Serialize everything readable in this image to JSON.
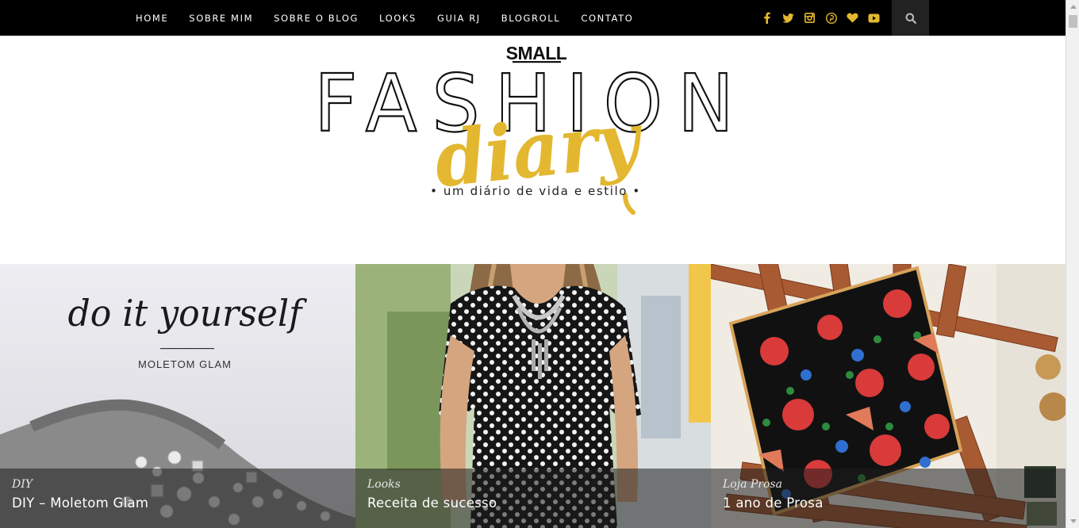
{
  "nav": {
    "items": [
      "HOME",
      "SOBRE MIM",
      "SOBRE O BLOG",
      "LOOKS",
      "GUIA RJ",
      "BLOGROLL",
      "CONTATO"
    ]
  },
  "social": {
    "icons": [
      "facebook-icon",
      "twitter-icon",
      "instagram-icon",
      "pinterest-icon",
      "bloglovin-heart-icon",
      "youtube-icon"
    ],
    "color": "#e3b730"
  },
  "logo": {
    "small": "SMALL",
    "fashion": "FASHION",
    "diary": "diary",
    "tagline": "• um diário de vida e estilo •",
    "accent": "#e3b730"
  },
  "posts": [
    {
      "category": "DIY",
      "title": "DIY – Moletom Glam",
      "image_text_script": "do it yourself",
      "image_text_caps": "MOLETOM GLAM"
    },
    {
      "category": "Looks",
      "title": "Receita de sucesso"
    },
    {
      "category": "Loja Prosa",
      "title": "1 ano de Prosa"
    }
  ]
}
